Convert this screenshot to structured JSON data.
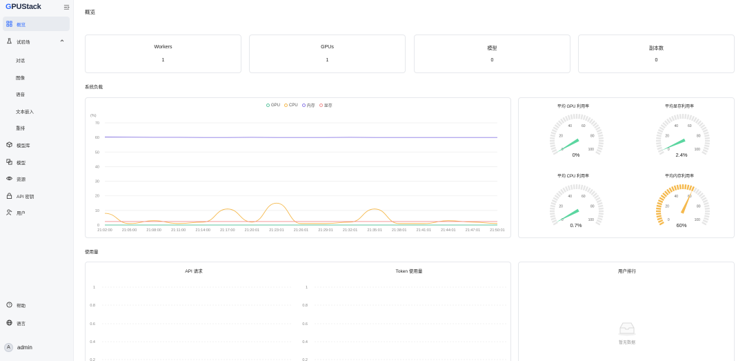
{
  "sidebar": {
    "logo": "GPUStack",
    "items": [
      {
        "label": "概览",
        "icon": "dashboard-icon"
      },
      {
        "label": "试验场",
        "icon": "playground-icon"
      },
      {
        "label": "模型库",
        "icon": "cube-icon"
      },
      {
        "label": "模型",
        "icon": "model-icon"
      },
      {
        "label": "资源",
        "icon": "eye-icon"
      },
      {
        "label": "API 密钥",
        "icon": "lock-icon"
      },
      {
        "label": "用户",
        "icon": "user-icon"
      }
    ],
    "subitems": [
      "对话",
      "图像",
      "语音",
      "文本嵌入",
      "重排"
    ],
    "bottom": [
      {
        "label": "帮助",
        "icon": "help-icon"
      },
      {
        "label": "语言",
        "icon": "globe-icon"
      }
    ],
    "user": {
      "initial": "A",
      "name": "admin"
    }
  },
  "header": {
    "title": "概览"
  },
  "stats": [
    {
      "title": "Workers",
      "value": "1"
    },
    {
      "title": "GPUs",
      "value": "1"
    },
    {
      "title": "模型",
      "value": "0"
    },
    {
      "title": "副本数",
      "value": "0"
    }
  ],
  "sections": {
    "load": "系统负载",
    "usage": "使用量"
  },
  "load_chart": {
    "legend": [
      {
        "name": "GPU",
        "color": "#5bc49f"
      },
      {
        "name": "CPU",
        "color": "#f5b94d"
      },
      {
        "name": "内存",
        "color": "#8c7ae6"
      },
      {
        "name": "显存",
        "color": "#f08c8c"
      }
    ],
    "unit": "(%)"
  },
  "chart_data": [
    {
      "type": "line",
      "title": "",
      "ylabel": "(%)",
      "ylim": [
        0,
        70
      ],
      "yticks": [
        0,
        10,
        20,
        30,
        40,
        50,
        60,
        70
      ],
      "x": [
        "21:02:00",
        "21:05:00",
        "21:08:00",
        "21:11:00",
        "21:14:00",
        "21:17:00",
        "21:20:01",
        "21:23:01",
        "21:26:01",
        "21:29:01",
        "21:32:01",
        "21:35:01",
        "21:38:01",
        "21:41:01",
        "21:44:01",
        "21:47:01",
        "21:50:01"
      ],
      "series": [
        {
          "name": "内存",
          "color": "#8c7ae6",
          "values": [
            60.3,
            60.2,
            60.1,
            60.1,
            60.0,
            60.0,
            60.1,
            60.0,
            60.0,
            60.0,
            60.1,
            60.0,
            60.0,
            60.0,
            60.0,
            60.0,
            60.0
          ]
        },
        {
          "name": "CPU",
          "color": "#f5b94d",
          "values": [
            8,
            1,
            3,
            1,
            2,
            11,
            2,
            15,
            1,
            1,
            2,
            11,
            1,
            1,
            3,
            2,
            1
          ]
        },
        {
          "name": "显存",
          "color": "#f08c8c",
          "values": [
            2.4,
            2.4,
            2.4,
            2.4,
            2.4,
            2.4,
            2.4,
            2.4,
            2.4,
            2.4,
            2.4,
            2.4,
            2.4,
            2.4,
            2.4,
            2.4,
            2.4
          ]
        },
        {
          "name": "GPU",
          "color": "#5bc49f",
          "values": [
            0,
            0,
            0,
            0,
            0,
            0,
            0,
            0,
            0,
            0,
            0,
            0,
            0,
            0,
            0,
            0,
            0
          ]
        }
      ]
    },
    {
      "type": "line",
      "title": "API 请求",
      "yticks": [
        "1",
        "0.8",
        "0.6",
        "0.4",
        "0.2"
      ],
      "series": []
    },
    {
      "type": "line",
      "title": "Token 使用量",
      "yticks": [
        "1",
        "0.8",
        "0.6",
        "0.4",
        "0.2"
      ],
      "series": []
    }
  ],
  "gauges": [
    {
      "title": "平均 GPU 利用率",
      "value": 0,
      "label": "0%",
      "color": "#5bd6a0"
    },
    {
      "title": "平均显存利用率",
      "value": 2.4,
      "label": "2.4%",
      "color": "#5bd6a0"
    },
    {
      "title": "平均 CPU 利用率",
      "value": 0.7,
      "label": "0.7%",
      "color": "#5bd6a0"
    },
    {
      "title": "平均内存利用率",
      "value": 60,
      "label": "60%",
      "color": "#f5b94d"
    }
  ],
  "gauge_ticks": [
    "0",
    "20",
    "40",
    "60",
    "80",
    "100"
  ],
  "usage": {
    "api_title": "API 请求",
    "token_title": "Token 使用量",
    "rank_title": "用户排行",
    "empty_text": "暂无数据"
  }
}
